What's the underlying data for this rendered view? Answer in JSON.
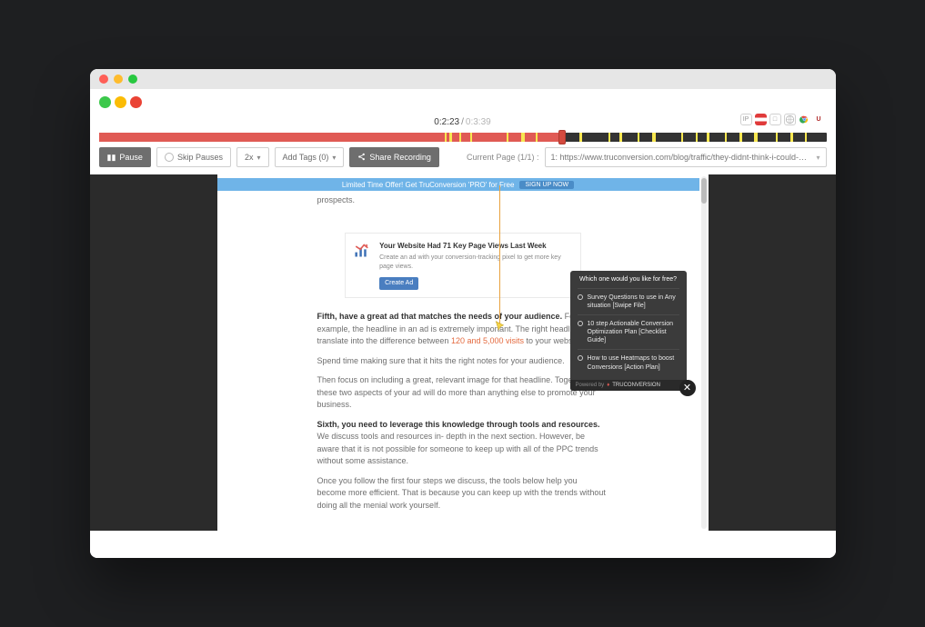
{
  "playback": {
    "current": "0:2:23",
    "total": "0:3:39",
    "progress_pct": 64,
    "speed": "2x"
  },
  "controls": {
    "pause": "Pause",
    "skip_pauses": "Skip Pauses",
    "add_tags": "Add Tags (0)",
    "share": "Share Recording"
  },
  "page_nav": {
    "label": "Current Page (1/1) :",
    "selected": "1: https://www.truconversion.com/blog/traffic/they-didnt-think-i-could-succeed-with-t..."
  },
  "meta": {
    "ip_label": "IP",
    "os_label": "□"
  },
  "banner": {
    "text": "Limited Time Offer! Get TruConversion 'PRO' for Free",
    "cta": "SIGN UP NOW"
  },
  "promo": {
    "title": "Your Website Had 71 Key Page Views Last Week",
    "sub": "Create an ad with your conversion-tracking pixel to get more key page views.",
    "btn": "Create Ad"
  },
  "article": {
    "lead_tail": "prospects.",
    "p5a": "Fifth, have a great ad that matches the needs of your audience.",
    "p5b": " For example, the headline in an ad is extremely important. The right headline can translate into the difference between ",
    "p5_link": "120 and 5,000 visits",
    "p5c": " to your website.",
    "p5d": "Spend time making sure that it hits the right notes for your audience.",
    "p5e": "Then focus on including a great, relevant image for that headline. Together these two aspects of your ad will do more than anything else to promote your business.",
    "p6a": "Sixth, you need to leverage this knowledge through tools and resources.",
    "p6b": " We discuss tools and resources in- depth in the next section. However, be aware that it is not possible for someone to keep up with all of the PPC trends without some assistance.",
    "p7": "Once you follow the first four steps we discuss, the tools below help you become more efficient. That is because you can keep up with the trends without doing all the menial work yourself."
  },
  "popup": {
    "title": "Which one would you like for free?",
    "opt1": "Survey Questions to use in Any situation [Swipe File]",
    "opt2": "10 step Actionable Conversion Optimization Plan [Checklist Guide]",
    "opt3": "How to use Heatmaps to boost Conversions [Action Plan]",
    "powered": "Powered by",
    "brand": "TRUCONVERSION"
  }
}
